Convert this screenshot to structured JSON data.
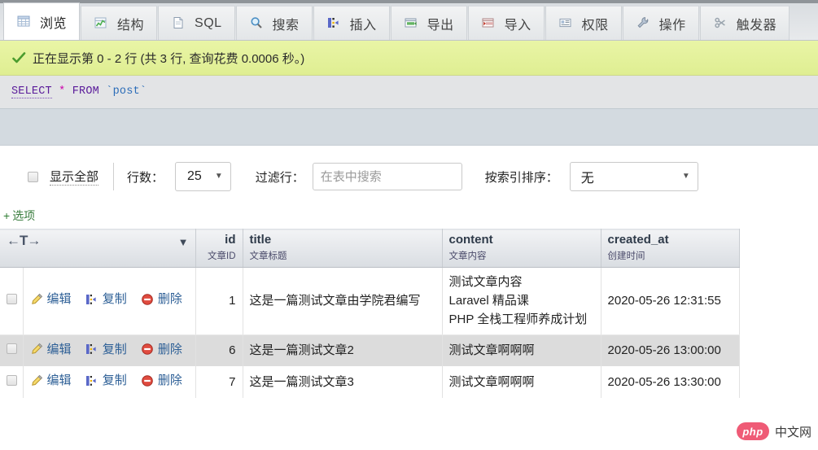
{
  "tabs": [
    {
      "label": "浏览",
      "icon": "browse-icon",
      "active": true
    },
    {
      "label": "结构",
      "icon": "structure-icon",
      "active": false
    },
    {
      "label": "SQL",
      "icon": "sql-icon",
      "active": false
    },
    {
      "label": "搜索",
      "icon": "search-icon",
      "active": false
    },
    {
      "label": "插入",
      "icon": "insert-icon",
      "active": false
    },
    {
      "label": "导出",
      "icon": "export-icon",
      "active": false
    },
    {
      "label": "导入",
      "icon": "import-icon",
      "active": false
    },
    {
      "label": "权限",
      "icon": "privileges-icon",
      "active": false
    },
    {
      "label": "操作",
      "icon": "operations-icon",
      "active": false
    },
    {
      "label": "触发器",
      "icon": "triggers-icon",
      "active": false
    }
  ],
  "notice": {
    "icon": "success-check-icon",
    "text": "正在显示第 0 - 2 行 (共 3 行, 查询花费 0.0006 秒。)"
  },
  "query": {
    "keyword_select": "SELECT",
    "star": "*",
    "keyword_from": "FROM",
    "backtick_open": "`",
    "table": "post",
    "backtick_close": "`"
  },
  "controls": {
    "show_all_label": "显示全部",
    "rows_label": "行数：",
    "rows_value": "25",
    "filter_label": "过滤行：",
    "filter_placeholder": "在表中搜索",
    "filter_value": "",
    "sort_label": "按索引排序：",
    "sort_value": "无"
  },
  "options_link": {
    "plus": "+",
    "label": "选项"
  },
  "table": {
    "sort_arrows": "←T→",
    "columns": [
      {
        "name": "id",
        "comment": "文章ID"
      },
      {
        "name": "title",
        "comment": "文章标题"
      },
      {
        "name": "content",
        "comment": "文章内容"
      },
      {
        "name": "created_at",
        "comment": "创建时间"
      }
    ],
    "row_actions": [
      {
        "label": "编辑",
        "icon": "pencil-icon"
      },
      {
        "label": "复制",
        "icon": "copy-icon"
      },
      {
        "label": "删除",
        "icon": "delete-icon"
      }
    ],
    "rows": [
      {
        "id": "1",
        "title": "这是一篇测试文章由学院君编写",
        "content_lines": [
          "测试文章内容",
          "Laravel 精品课",
          "PHP 全栈工程师养成计划"
        ],
        "created_at": "2020-05-26 12:31:55"
      },
      {
        "id": "6",
        "title": "这是一篇测试文章2",
        "content_lines": [
          "测试文章啊啊啊"
        ],
        "created_at": "2020-05-26 13:00:00"
      },
      {
        "id": "7",
        "title": "这是一篇测试文章3",
        "content_lines": [
          "测试文章啊啊啊"
        ],
        "created_at": "2020-05-26 13:30:00"
      }
    ]
  },
  "watermark": {
    "logo": "php",
    "text": "中文网"
  }
}
